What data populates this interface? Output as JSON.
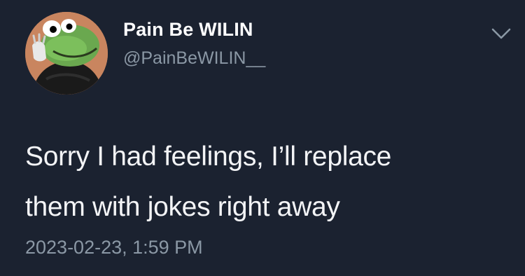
{
  "tweet": {
    "author_name": "Pain Be WILIN",
    "author_handle": "@PainBeWILIN__",
    "text_line_1": "Sorry I had feelings, I’ll replace",
    "text_line_2": "them with jokes right away",
    "timestamp": "2023-02-23, 1:59 PM"
  },
  "icons": {
    "menu": "chevron-down-icon",
    "avatar": "frog-avatar"
  },
  "colors": {
    "background": "#1b2230",
    "secondary_text": "#8b98a5",
    "primary_text": "#ffffff"
  }
}
